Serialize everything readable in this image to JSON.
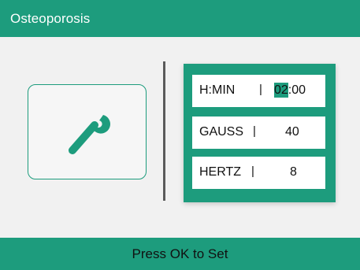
{
  "header": {
    "title": "Osteoporosis"
  },
  "tool": {
    "icon": "wrench-icon"
  },
  "settings": [
    {
      "label": "H:MIN",
      "separator": "|",
      "value_highlighted": "02",
      "value_rest": ":00"
    },
    {
      "label": "GAUSS",
      "separator": "|",
      "value": "40"
    },
    {
      "label": "HERTZ",
      "separator": "|",
      "value": "8"
    }
  ],
  "footer": {
    "hint": "Press OK to Set"
  },
  "colors": {
    "accent": "#1d9c7d",
    "background": "#f1f1f1",
    "field": "#ffffff",
    "divider": "#5a5a5a"
  }
}
